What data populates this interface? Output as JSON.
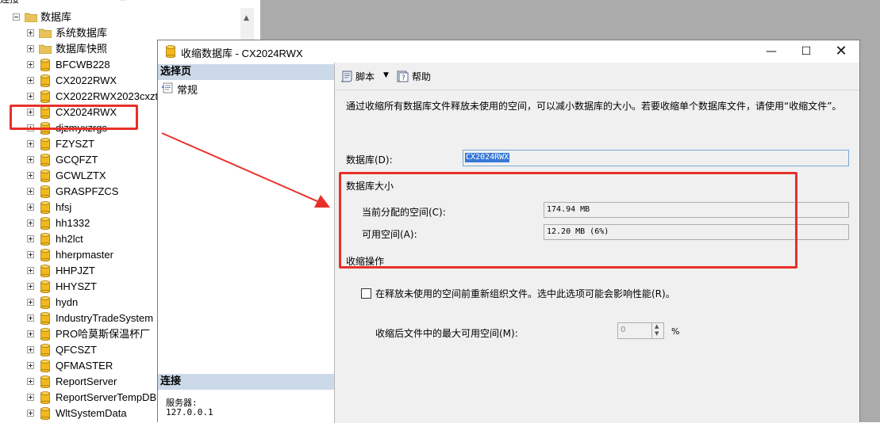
{
  "explorer": {
    "toolbar_label": "连接",
    "root": {
      "label": "数据库"
    },
    "folders": [
      "系统数据库",
      "数据库快照"
    ],
    "databases": [
      "BFCWB228",
      "CX2022RWX",
      "CX2022RWX2023cxzt",
      "CX2024RWX",
      "djzmyxzrgs",
      "FZYSZT",
      "GCQFZT",
      "GCWLZTX",
      "GRASPFZCS",
      "hfsj",
      "hh1332",
      "hh2lct",
      "hherpmaster",
      "HHPJZT",
      "HHYSZT",
      "hydn",
      "IndustryTradeSystem",
      "PRO哈莫斯保温杯厂",
      "QFCSZT",
      "QFMASTER",
      "ReportServer",
      "ReportServerTempDB",
      "WltSystemData"
    ]
  },
  "dialog": {
    "title": "收缩数据库 - CX2024RWX",
    "minimize_glyph": "—",
    "maximize_glyph": "☐",
    "close_glyph": "✕"
  },
  "left_pane": {
    "select_page_header": "选择页",
    "pages": [
      "常规"
    ],
    "connection_header": "连接",
    "server_label": "服务器:",
    "server_value": "127.0.0.1"
  },
  "toolbar": {
    "script_label": "脚本",
    "help_label": "帮助"
  },
  "general": {
    "description": "通过收缩所有数据库文件释放未使用的空间，可以减小数据库的大小。若要收缩单个数据库文件，请使用“收缩文件”。",
    "database_label": "数据库(D):",
    "database_value": "CX2024RWX",
    "db_size_heading": "数据库大小",
    "allocated_label": "当前分配的空间(C):",
    "allocated_value": "174.94 MB",
    "available_label": "可用空间(A):",
    "available_value": "12.20 MB (6%)",
    "shrink_heading": "收缩操作",
    "reorganize_label": "在释放未使用的空间前重新组织文件。选中此选项可能会影响性能(R)。",
    "reorganize_checked": false,
    "max_free_label": "收缩后文件中的最大可用空间(M):",
    "max_free_value": "0",
    "percent_sign": "%"
  },
  "annotation_color": "#e8302a",
  "db_icon_color": "#f2b81e",
  "folder_icon_color": "#e8c25a"
}
